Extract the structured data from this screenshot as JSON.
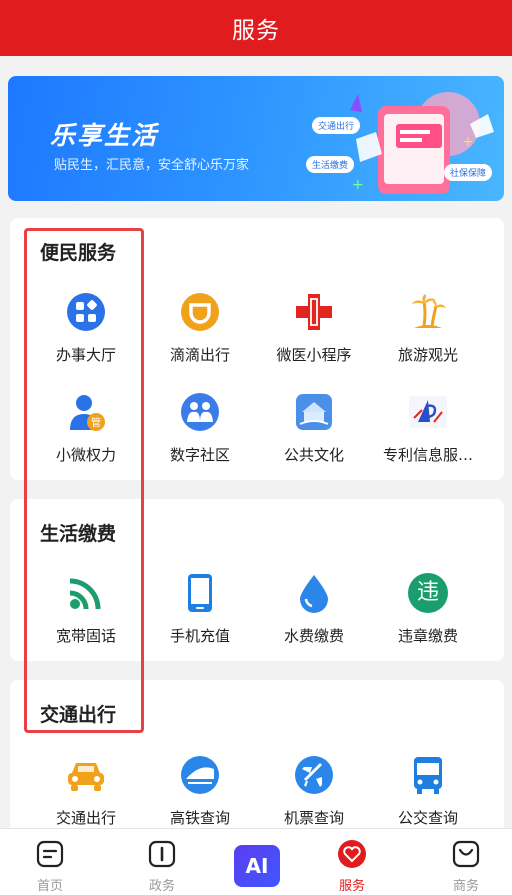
{
  "header": {
    "title": "服务"
  },
  "banner": {
    "title": "乐享生活",
    "subtitle": "贴民生，汇民意，安全舒心乐万家",
    "tags": [
      "交通出行",
      "生活缴费",
      "社保保障"
    ]
  },
  "sections": [
    {
      "title": "便民服务",
      "items": [
        {
          "label": "办事大厅",
          "icon": "office-hall-icon"
        },
        {
          "label": "滴滴出行",
          "icon": "didi-icon"
        },
        {
          "label": "微医小程序",
          "icon": "medical-cross-icon"
        },
        {
          "label": "旅游观光",
          "icon": "palm-tree-icon"
        },
        {
          "label": "小微权力",
          "icon": "official-user-icon"
        },
        {
          "label": "数字社区",
          "icon": "community-icon"
        },
        {
          "label": "公共文化",
          "icon": "culture-building-icon"
        },
        {
          "label": "专利信息服…",
          "icon": "patent-icon"
        }
      ]
    },
    {
      "title": "生活缴费",
      "items": [
        {
          "label": "宽带固话",
          "icon": "wifi-signal-icon"
        },
        {
          "label": "手机充值",
          "icon": "phone-icon"
        },
        {
          "label": "水费缴费",
          "icon": "water-drop-icon"
        },
        {
          "label": "违章缴费",
          "icon": "violation-icon",
          "glyph": "违"
        }
      ]
    },
    {
      "title": "交通出行",
      "items": [
        {
          "label": "交通出行",
          "icon": "car-icon"
        },
        {
          "label": "高铁查询",
          "icon": "train-icon"
        },
        {
          "label": "机票查询",
          "icon": "airplane-icon"
        },
        {
          "label": "公交查询",
          "icon": "bus-icon"
        }
      ]
    }
  ],
  "tabbar": {
    "items": [
      {
        "label": "首页",
        "icon": "home-doc-icon"
      },
      {
        "label": "政务",
        "icon": "government-icon"
      },
      {
        "label": "AI",
        "icon": "ai-icon"
      },
      {
        "label": "服务",
        "icon": "heart-icon",
        "active": true
      },
      {
        "label": "商务",
        "icon": "shopping-bag-icon"
      }
    ]
  },
  "colors": {
    "brand": "#e11c1e",
    "highlight": "#e84141"
  }
}
